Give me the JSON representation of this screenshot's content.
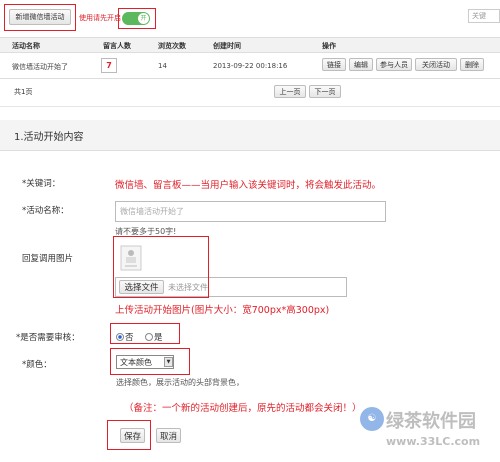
{
  "toolbar": {
    "new_button": "新增微信墙活动",
    "toggle_hint": "使用请先开启",
    "toggle_state": "开",
    "search_placeholder": "关键"
  },
  "table": {
    "headers": [
      "活动名称",
      "留言人数",
      "浏览次数",
      "创建时间",
      "操作"
    ],
    "rows": [
      {
        "name": "微信墙活动开始了",
        "messages": "7",
        "views": "14",
        "created": "2013-09-22 00:18:16",
        "actions": [
          "链接",
          "编辑",
          "参与人员",
          "关闭活动",
          "删除"
        ]
      }
    ]
  },
  "pagination": {
    "total": "共1页",
    "prev": "上一页",
    "next": "下一页"
  },
  "section": {
    "title": "1.活动开始内容"
  },
  "form": {
    "keyword_label": "*关键词：",
    "keyword_note": "微信墙、留言板——当用户输入该关键词时，将会触发此活动。",
    "name_label": "*活动名称：",
    "name_placeholder": "微信墙活动开始了",
    "name_hint": "请不要多于50字!",
    "image_label": "回复调用图片",
    "file_button": "选择文件",
    "file_status": "未选择文件",
    "upload_note": "上传活动开始图片(图片大小：宽700px*高300px)",
    "review_label": "*是否需要审核：",
    "review_no": "否",
    "review_yes": "是",
    "color_label": "*颜色：",
    "color_select": "文本颜色",
    "color_hint": "选择颜色，展示活动的头部背景色，",
    "remark": "（备注：一个新的活动创建后，原先的活动都会关闭！）",
    "save": "保存",
    "cancel": "取消"
  },
  "watermark": {
    "brand": "绿茶软件园",
    "url": "www.33LC.com"
  },
  "colors": {
    "accent_red": "#e0202a",
    "toggle_green": "#5cb85c"
  }
}
